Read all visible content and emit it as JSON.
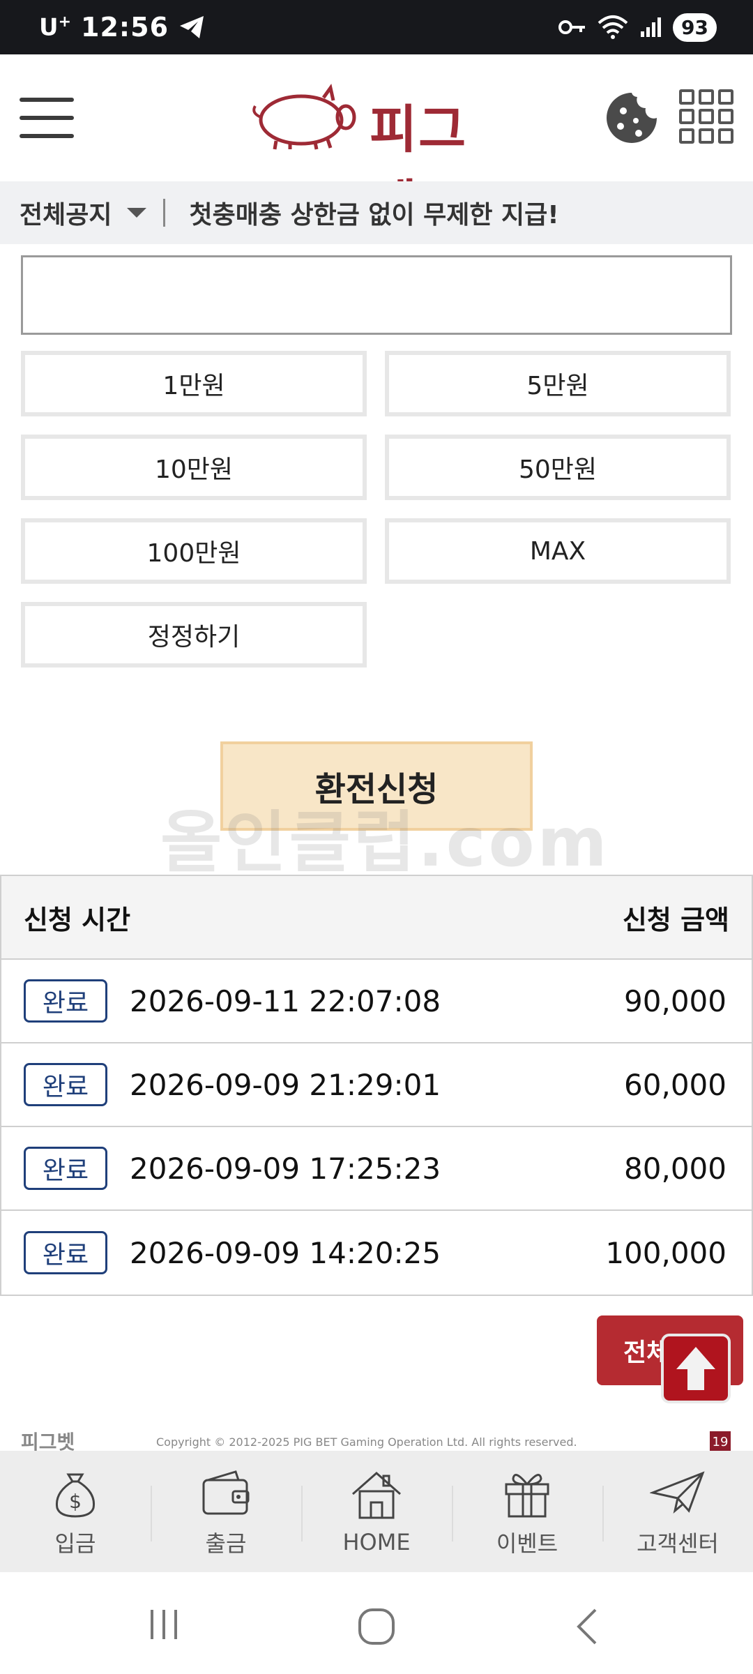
{
  "status_bar": {
    "carrier": "U",
    "carrier_sup": "+",
    "time": "12:56",
    "battery": "93"
  },
  "header": {
    "logo_text": "피그벳"
  },
  "notice": {
    "label": "전체공지",
    "text": "첫충매충 상한금 없이 무제한 지급!"
  },
  "amount_input": {
    "value": "",
    "placeholder": ""
  },
  "quick_buttons": [
    "1만원",
    "5만원",
    "10만원",
    "50만원",
    "100만원",
    "MAX",
    "정정하기"
  ],
  "submit_label": "환전신청",
  "watermark": "올인클럽.com",
  "table": {
    "header_time": "신청 시간",
    "header_amount": "신청 금액",
    "rows": [
      {
        "status": "완료",
        "time": "2026-09-11 22:07:08",
        "amount": "90,000"
      },
      {
        "status": "완료",
        "time": "2026-09-09 21:29:01",
        "amount": "60,000"
      },
      {
        "status": "완료",
        "time": "2026-09-09 17:25:23",
        "amount": "80,000"
      },
      {
        "status": "완료",
        "time": "2026-09-09 14:20:25",
        "amount": "100,000"
      }
    ]
  },
  "view_all_label": "전체",
  "footer": {
    "logo": "피그벳",
    "copyright": "Copyright © 2012-2025 PIG BET Gaming Operation Ltd. All rights reserved.",
    "age_badge": "19"
  },
  "bottom_nav": [
    {
      "label": "입금",
      "icon": "money-bag-icon"
    },
    {
      "label": "출금",
      "icon": "wallet-icon"
    },
    {
      "label": "HOME",
      "icon": "home-icon"
    },
    {
      "label": "이벤트",
      "icon": "gift-icon"
    },
    {
      "label": "고객센터",
      "icon": "paper-plane-icon"
    }
  ],
  "colors": {
    "brand": "#9e2a35",
    "badge": "#1f3f7a",
    "submit_bg": "#f8e6c7",
    "view_all": "#b52b31"
  }
}
